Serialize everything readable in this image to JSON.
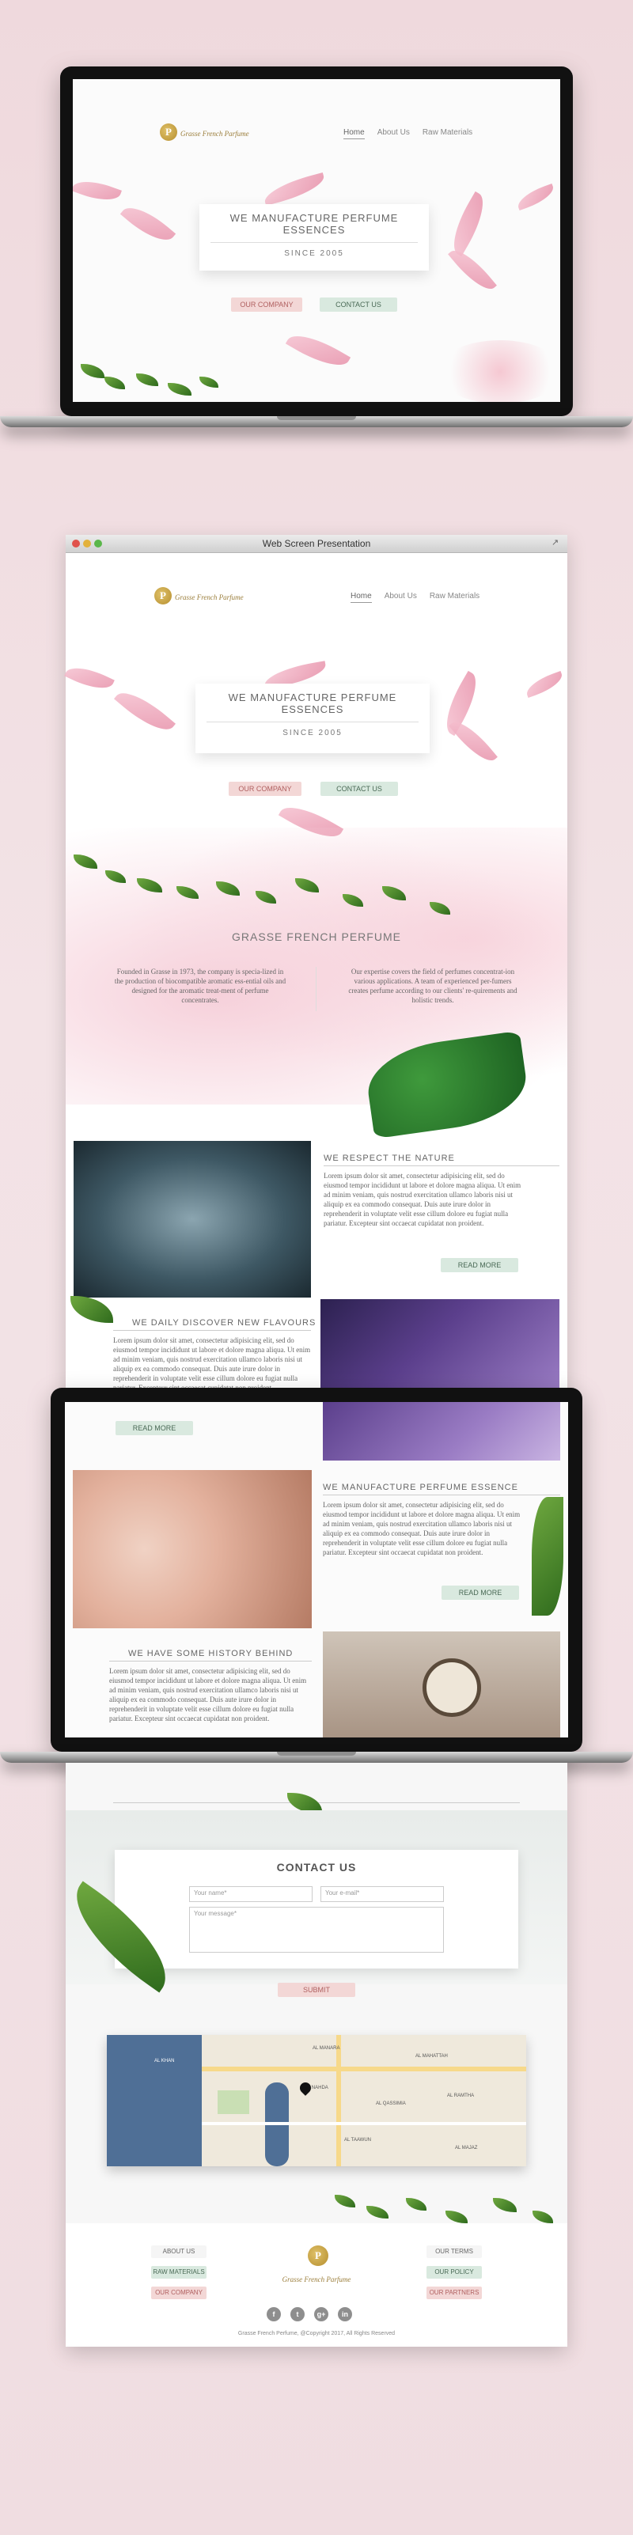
{
  "brand": {
    "logo_letter": "P",
    "logo_text": "Grasse French Parfume",
    "footer_logo_text": "Grasse French Parfume"
  },
  "nav": {
    "home": "Home",
    "about": "About Us",
    "raw": "Raw Materials"
  },
  "hero": {
    "title": "WE MANUFACTURE PERFUME ESSENCES",
    "subtitle": "SINCE 2005",
    "btn_company": "OUR COMPANY",
    "btn_contact": "CONTACT US"
  },
  "browser": {
    "title": "Web Screen Presentation"
  },
  "about": {
    "title": "GRASSE FRENCH PERFUME",
    "left_text": "Founded in Grasse in 1973, the company is specia-lized in the production of biocompatible aromatic ess-ential oils and designed for the aromatic treat-ment of perfume concentrates.",
    "right_text": "Our expertise covers the field of perfumes concentrat-ion various applications. A team of experienced per-fumers creates perfume according to our clients' re-quirements and holistic trends."
  },
  "sections": {
    "nature": "WE RESPECT THE NATURE",
    "flavours": "WE DAILY DISCOVER NEW FLAVOURS",
    "essence": "WE MANUFACTURE PERFUME ESSENCE",
    "history": "WE HAVE SOME HISTORY BEHIND",
    "lorem": "Lorem ipsum dolor sit amet, consectetur adipisicing elit, sed do eiusmod tempor incididunt ut labore et dolore magna aliqua. Ut enim ad minim veniam, quis nostrud exercitation ullamco laboris nisi ut aliquip ex ea commodo consequat. Duis aute irure dolor in reprehenderit in voluptate velit esse cillum dolore eu fugiat nulla pariatur. Excepteur sint occaecat cupidatat non proident.",
    "read_more": "READ MORE"
  },
  "contact": {
    "title": "CONTACT US",
    "name_ph": "Your name*",
    "email_ph": "Your e-mail*",
    "message_ph": "Your message*",
    "submit": "SUBMIT"
  },
  "map_labels": [
    "AL MANARA",
    "AL MAHATTAH",
    "AL NAHDA",
    "AL QASSIMIA",
    "AL RAMTHA",
    "AL KHAN",
    "AL TAAWUN",
    "AL MAJAZ"
  ],
  "footer": {
    "about": "ABOUT US",
    "raw": "RAW MATERIALS",
    "company": "OUR COMPANY",
    "terms": "OUR TERMS",
    "policy": "OUR POLICY",
    "partners": "OUR PARTNERS",
    "social": [
      "f",
      "t",
      "g+",
      "in"
    ],
    "copyright": "Grasse French Perfume, @Copyright 2017, All Rights Reserved"
  }
}
